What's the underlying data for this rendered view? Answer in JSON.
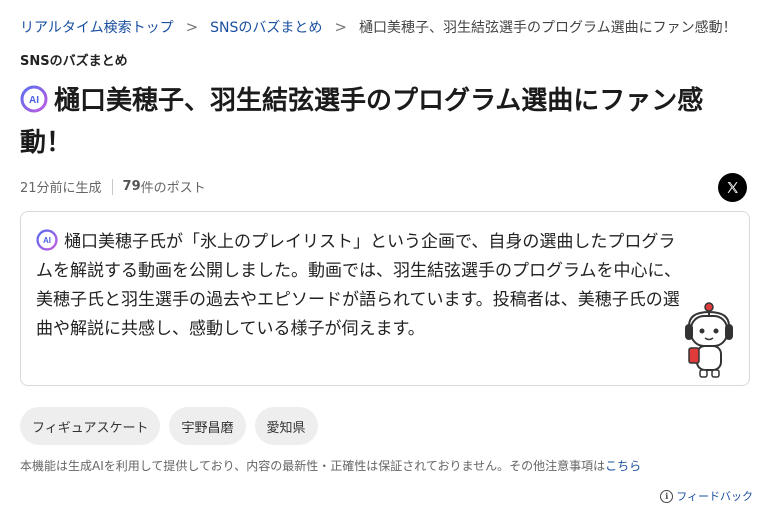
{
  "breadcrumb": {
    "items": [
      {
        "label": "リアルタイム検索トップ"
      },
      {
        "label": "SNSのバズまとめ"
      }
    ],
    "current": "樋口美穂子、羽生結弦選手のプログラム選曲にファン感動！",
    "separator": ">"
  },
  "category": "SNSのバズまとめ",
  "title": "樋口美穂子、羽生結弦選手のプログラム選曲にファン感動！",
  "ai_badge_label": "AI",
  "meta": {
    "time": "21分前に生成",
    "post_count": "79",
    "post_suffix": "件のポスト"
  },
  "share": {
    "icon": "x-logo-icon",
    "label": "X"
  },
  "summary": {
    "text": "樋口美穂子氏が「氷上のプレイリスト」という企画で、自身の選曲したプログラムを解説する動画を公開しました。動画では、羽生結弦選手のプログラムを中心に、美穂子氏と羽生選手の過去やエピソードが語られています。投稿者は、美穂子氏の選曲や解説に共感し、感動している様子が伺えます。"
  },
  "tags": [
    {
      "label": "フィギュアスケート"
    },
    {
      "label": "宇野昌磨"
    },
    {
      "label": "愛知県"
    }
  ],
  "disclaimer": {
    "text": "本機能は生成AIを利用して提供しており、内容の最新性・正確性は保証されておりません。その他注意事項は",
    "link": "こちら"
  },
  "feedback": {
    "icon": "info-icon",
    "label": "フィードバック"
  },
  "colors": {
    "link": "#1a4fa0",
    "ai_gradient_start": "#5a6ff0",
    "ai_gradient_end": "#c25ee0",
    "tag_bg": "#eeeeee",
    "border": "#d9d9d9"
  }
}
